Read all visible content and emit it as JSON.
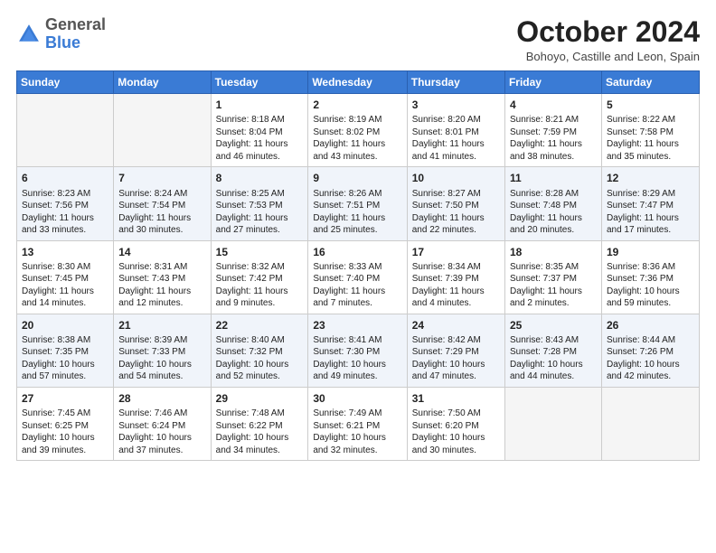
{
  "logo": {
    "general": "General",
    "blue": "Blue"
  },
  "title": "October 2024",
  "subtitle": "Bohoyo, Castille and Leon, Spain",
  "days": [
    "Sunday",
    "Monday",
    "Tuesday",
    "Wednesday",
    "Thursday",
    "Friday",
    "Saturday"
  ],
  "weeks": [
    [
      {
        "day": "",
        "info": ""
      },
      {
        "day": "",
        "info": ""
      },
      {
        "day": "1",
        "info": "Sunrise: 8:18 AM\nSunset: 8:04 PM\nDaylight: 11 hours and 46 minutes."
      },
      {
        "day": "2",
        "info": "Sunrise: 8:19 AM\nSunset: 8:02 PM\nDaylight: 11 hours and 43 minutes."
      },
      {
        "day": "3",
        "info": "Sunrise: 8:20 AM\nSunset: 8:01 PM\nDaylight: 11 hours and 41 minutes."
      },
      {
        "day": "4",
        "info": "Sunrise: 8:21 AM\nSunset: 7:59 PM\nDaylight: 11 hours and 38 minutes."
      },
      {
        "day": "5",
        "info": "Sunrise: 8:22 AM\nSunset: 7:58 PM\nDaylight: 11 hours and 35 minutes."
      }
    ],
    [
      {
        "day": "6",
        "info": "Sunrise: 8:23 AM\nSunset: 7:56 PM\nDaylight: 11 hours and 33 minutes."
      },
      {
        "day": "7",
        "info": "Sunrise: 8:24 AM\nSunset: 7:54 PM\nDaylight: 11 hours and 30 minutes."
      },
      {
        "day": "8",
        "info": "Sunrise: 8:25 AM\nSunset: 7:53 PM\nDaylight: 11 hours and 27 minutes."
      },
      {
        "day": "9",
        "info": "Sunrise: 8:26 AM\nSunset: 7:51 PM\nDaylight: 11 hours and 25 minutes."
      },
      {
        "day": "10",
        "info": "Sunrise: 8:27 AM\nSunset: 7:50 PM\nDaylight: 11 hours and 22 minutes."
      },
      {
        "day": "11",
        "info": "Sunrise: 8:28 AM\nSunset: 7:48 PM\nDaylight: 11 hours and 20 minutes."
      },
      {
        "day": "12",
        "info": "Sunrise: 8:29 AM\nSunset: 7:47 PM\nDaylight: 11 hours and 17 minutes."
      }
    ],
    [
      {
        "day": "13",
        "info": "Sunrise: 8:30 AM\nSunset: 7:45 PM\nDaylight: 11 hours and 14 minutes."
      },
      {
        "day": "14",
        "info": "Sunrise: 8:31 AM\nSunset: 7:43 PM\nDaylight: 11 hours and 12 minutes."
      },
      {
        "day": "15",
        "info": "Sunrise: 8:32 AM\nSunset: 7:42 PM\nDaylight: 11 hours and 9 minutes."
      },
      {
        "day": "16",
        "info": "Sunrise: 8:33 AM\nSunset: 7:40 PM\nDaylight: 11 hours and 7 minutes."
      },
      {
        "day": "17",
        "info": "Sunrise: 8:34 AM\nSunset: 7:39 PM\nDaylight: 11 hours and 4 minutes."
      },
      {
        "day": "18",
        "info": "Sunrise: 8:35 AM\nSunset: 7:37 PM\nDaylight: 11 hours and 2 minutes."
      },
      {
        "day": "19",
        "info": "Sunrise: 8:36 AM\nSunset: 7:36 PM\nDaylight: 10 hours and 59 minutes."
      }
    ],
    [
      {
        "day": "20",
        "info": "Sunrise: 8:38 AM\nSunset: 7:35 PM\nDaylight: 10 hours and 57 minutes."
      },
      {
        "day": "21",
        "info": "Sunrise: 8:39 AM\nSunset: 7:33 PM\nDaylight: 10 hours and 54 minutes."
      },
      {
        "day": "22",
        "info": "Sunrise: 8:40 AM\nSunset: 7:32 PM\nDaylight: 10 hours and 52 minutes."
      },
      {
        "day": "23",
        "info": "Sunrise: 8:41 AM\nSunset: 7:30 PM\nDaylight: 10 hours and 49 minutes."
      },
      {
        "day": "24",
        "info": "Sunrise: 8:42 AM\nSunset: 7:29 PM\nDaylight: 10 hours and 47 minutes."
      },
      {
        "day": "25",
        "info": "Sunrise: 8:43 AM\nSunset: 7:28 PM\nDaylight: 10 hours and 44 minutes."
      },
      {
        "day": "26",
        "info": "Sunrise: 8:44 AM\nSunset: 7:26 PM\nDaylight: 10 hours and 42 minutes."
      }
    ],
    [
      {
        "day": "27",
        "info": "Sunrise: 7:45 AM\nSunset: 6:25 PM\nDaylight: 10 hours and 39 minutes."
      },
      {
        "day": "28",
        "info": "Sunrise: 7:46 AM\nSunset: 6:24 PM\nDaylight: 10 hours and 37 minutes."
      },
      {
        "day": "29",
        "info": "Sunrise: 7:48 AM\nSunset: 6:22 PM\nDaylight: 10 hours and 34 minutes."
      },
      {
        "day": "30",
        "info": "Sunrise: 7:49 AM\nSunset: 6:21 PM\nDaylight: 10 hours and 32 minutes."
      },
      {
        "day": "31",
        "info": "Sunrise: 7:50 AM\nSunset: 6:20 PM\nDaylight: 10 hours and 30 minutes."
      },
      {
        "day": "",
        "info": ""
      },
      {
        "day": "",
        "info": ""
      }
    ]
  ]
}
